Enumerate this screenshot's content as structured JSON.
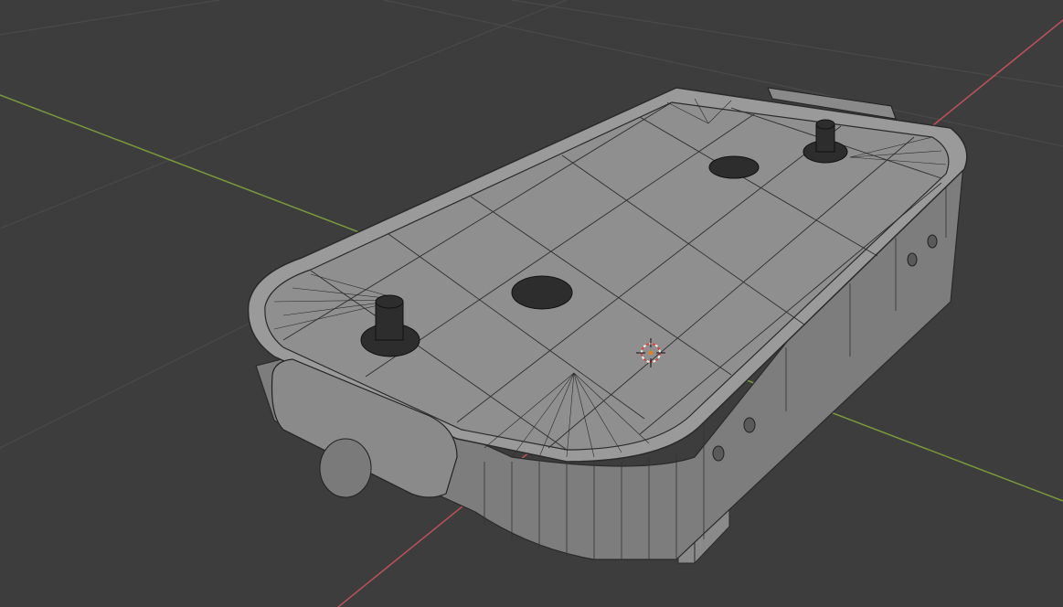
{
  "viewport": {
    "background_color": "#3d3d3d",
    "grid_color": "#4a4a4a",
    "x_axis_color": "#c0505a",
    "y_axis_color": "#7a9a3a"
  },
  "model": {
    "surface_color": "#8f8f8f",
    "side_color": "#7a7a7a",
    "wire_color": "#2a2a2a",
    "part_color": "#2d2d2d"
  },
  "cursor_3d": {
    "icon": "3d-cursor-icon",
    "ring_colors": [
      "#e04040",
      "#f0f0f0"
    ]
  }
}
